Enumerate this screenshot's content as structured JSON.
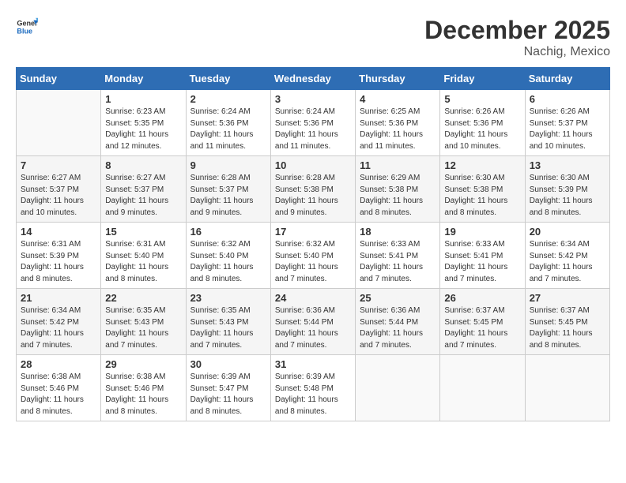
{
  "header": {
    "logo_general": "General",
    "logo_blue": "Blue",
    "month_title": "December 2025",
    "location": "Nachig, Mexico"
  },
  "days_of_week": [
    "Sunday",
    "Monday",
    "Tuesday",
    "Wednesday",
    "Thursday",
    "Friday",
    "Saturday"
  ],
  "weeks": [
    [
      {
        "day": "",
        "info": ""
      },
      {
        "day": "1",
        "info": "Sunrise: 6:23 AM\nSunset: 5:35 PM\nDaylight: 11 hours\nand 12 minutes."
      },
      {
        "day": "2",
        "info": "Sunrise: 6:24 AM\nSunset: 5:36 PM\nDaylight: 11 hours\nand 11 minutes."
      },
      {
        "day": "3",
        "info": "Sunrise: 6:24 AM\nSunset: 5:36 PM\nDaylight: 11 hours\nand 11 minutes."
      },
      {
        "day": "4",
        "info": "Sunrise: 6:25 AM\nSunset: 5:36 PM\nDaylight: 11 hours\nand 11 minutes."
      },
      {
        "day": "5",
        "info": "Sunrise: 6:26 AM\nSunset: 5:36 PM\nDaylight: 11 hours\nand 10 minutes."
      },
      {
        "day": "6",
        "info": "Sunrise: 6:26 AM\nSunset: 5:37 PM\nDaylight: 11 hours\nand 10 minutes."
      }
    ],
    [
      {
        "day": "7",
        "info": "Sunrise: 6:27 AM\nSunset: 5:37 PM\nDaylight: 11 hours\nand 10 minutes."
      },
      {
        "day": "8",
        "info": "Sunrise: 6:27 AM\nSunset: 5:37 PM\nDaylight: 11 hours\nand 9 minutes."
      },
      {
        "day": "9",
        "info": "Sunrise: 6:28 AM\nSunset: 5:37 PM\nDaylight: 11 hours\nand 9 minutes."
      },
      {
        "day": "10",
        "info": "Sunrise: 6:28 AM\nSunset: 5:38 PM\nDaylight: 11 hours\nand 9 minutes."
      },
      {
        "day": "11",
        "info": "Sunrise: 6:29 AM\nSunset: 5:38 PM\nDaylight: 11 hours\nand 8 minutes."
      },
      {
        "day": "12",
        "info": "Sunrise: 6:30 AM\nSunset: 5:38 PM\nDaylight: 11 hours\nand 8 minutes."
      },
      {
        "day": "13",
        "info": "Sunrise: 6:30 AM\nSunset: 5:39 PM\nDaylight: 11 hours\nand 8 minutes."
      }
    ],
    [
      {
        "day": "14",
        "info": "Sunrise: 6:31 AM\nSunset: 5:39 PM\nDaylight: 11 hours\nand 8 minutes."
      },
      {
        "day": "15",
        "info": "Sunrise: 6:31 AM\nSunset: 5:40 PM\nDaylight: 11 hours\nand 8 minutes."
      },
      {
        "day": "16",
        "info": "Sunrise: 6:32 AM\nSunset: 5:40 PM\nDaylight: 11 hours\nand 8 minutes."
      },
      {
        "day": "17",
        "info": "Sunrise: 6:32 AM\nSunset: 5:40 PM\nDaylight: 11 hours\nand 7 minutes."
      },
      {
        "day": "18",
        "info": "Sunrise: 6:33 AM\nSunset: 5:41 PM\nDaylight: 11 hours\nand 7 minutes."
      },
      {
        "day": "19",
        "info": "Sunrise: 6:33 AM\nSunset: 5:41 PM\nDaylight: 11 hours\nand 7 minutes."
      },
      {
        "day": "20",
        "info": "Sunrise: 6:34 AM\nSunset: 5:42 PM\nDaylight: 11 hours\nand 7 minutes."
      }
    ],
    [
      {
        "day": "21",
        "info": "Sunrise: 6:34 AM\nSunset: 5:42 PM\nDaylight: 11 hours\nand 7 minutes."
      },
      {
        "day": "22",
        "info": "Sunrise: 6:35 AM\nSunset: 5:43 PM\nDaylight: 11 hours\nand 7 minutes."
      },
      {
        "day": "23",
        "info": "Sunrise: 6:35 AM\nSunset: 5:43 PM\nDaylight: 11 hours\nand 7 minutes."
      },
      {
        "day": "24",
        "info": "Sunrise: 6:36 AM\nSunset: 5:44 PM\nDaylight: 11 hours\nand 7 minutes."
      },
      {
        "day": "25",
        "info": "Sunrise: 6:36 AM\nSunset: 5:44 PM\nDaylight: 11 hours\nand 7 minutes."
      },
      {
        "day": "26",
        "info": "Sunrise: 6:37 AM\nSunset: 5:45 PM\nDaylight: 11 hours\nand 7 minutes."
      },
      {
        "day": "27",
        "info": "Sunrise: 6:37 AM\nSunset: 5:45 PM\nDaylight: 11 hours\nand 8 minutes."
      }
    ],
    [
      {
        "day": "28",
        "info": "Sunrise: 6:38 AM\nSunset: 5:46 PM\nDaylight: 11 hours\nand 8 minutes."
      },
      {
        "day": "29",
        "info": "Sunrise: 6:38 AM\nSunset: 5:46 PM\nDaylight: 11 hours\nand 8 minutes."
      },
      {
        "day": "30",
        "info": "Sunrise: 6:39 AM\nSunset: 5:47 PM\nDaylight: 11 hours\nand 8 minutes."
      },
      {
        "day": "31",
        "info": "Sunrise: 6:39 AM\nSunset: 5:48 PM\nDaylight: 11 hours\nand 8 minutes."
      },
      {
        "day": "",
        "info": ""
      },
      {
        "day": "",
        "info": ""
      },
      {
        "day": "",
        "info": ""
      }
    ]
  ]
}
